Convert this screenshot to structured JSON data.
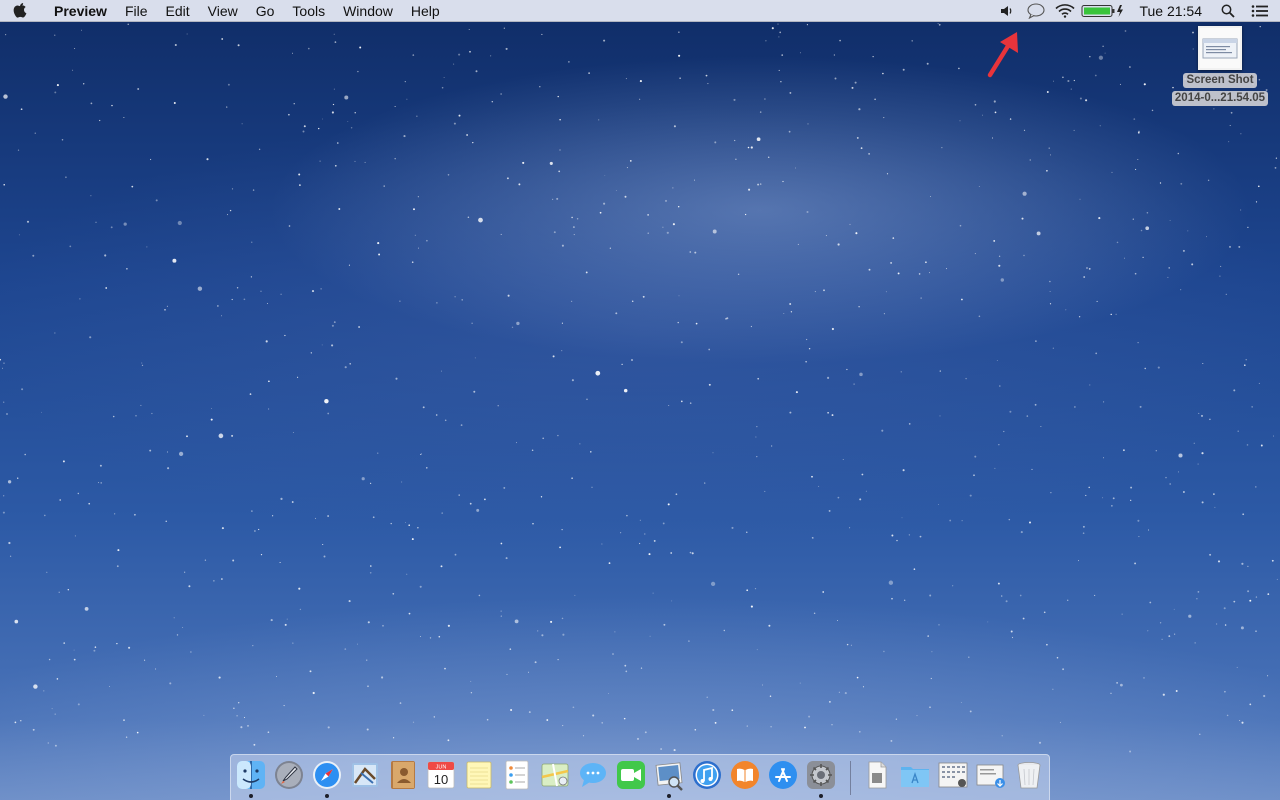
{
  "app": "Preview",
  "menubar": {
    "items": [
      {
        "name": "menu-file",
        "label": "File"
      },
      {
        "name": "menu-edit",
        "label": "Edit"
      },
      {
        "name": "menu-view",
        "label": "View"
      },
      {
        "name": "menu-go",
        "label": "Go"
      },
      {
        "name": "menu-tools",
        "label": "Tools"
      },
      {
        "name": "menu-window",
        "label": "Window"
      },
      {
        "name": "menu-help",
        "label": "Help"
      }
    ],
    "status": {
      "icons": [
        "volume-icon",
        "notification-bubble-icon",
        "wifi-icon",
        "battery-charging-icon",
        "spotlight-search-icon",
        "notification-center-icon"
      ],
      "clock": "Tue 21:54"
    }
  },
  "desktop": {
    "file": {
      "name_line1": "Screen Shot",
      "name_line2": "2014-0...21.54.05"
    },
    "annotation": "red-arrow-icon"
  },
  "dock": {
    "apps": [
      {
        "icon": "finder-icon",
        "running": true
      },
      {
        "icon": "launchpad-icon",
        "running": false
      },
      {
        "icon": "safari-icon",
        "running": true
      },
      {
        "icon": "mail-icon",
        "running": false
      },
      {
        "icon": "contacts-icon",
        "running": false
      },
      {
        "icon": "calendar-icon",
        "running": false,
        "month": "JUN",
        "day": "10"
      },
      {
        "icon": "notes-icon",
        "running": false
      },
      {
        "icon": "reminders-icon",
        "running": false
      },
      {
        "icon": "maps-icon",
        "running": false
      },
      {
        "icon": "messages-icon",
        "running": false
      },
      {
        "icon": "facetime-icon",
        "running": false
      },
      {
        "icon": "preview-icon",
        "running": true
      },
      {
        "icon": "itunes-icon",
        "running": false
      },
      {
        "icon": "ibooks-icon",
        "running": false
      },
      {
        "icon": "app-store-icon",
        "running": false
      },
      {
        "icon": "system-preferences-icon",
        "running": true
      }
    ],
    "stacks": [
      {
        "icon": "document-stack-icon"
      },
      {
        "icon": "applications-folder-icon"
      },
      {
        "icon": "screenshots-stack-icon"
      },
      {
        "icon": "downloads-stack-icon"
      },
      {
        "icon": "trash-icon"
      }
    ],
    "colors": {
      "background": "#c8d6ee",
      "running_dot": "#1d1f2a"
    }
  },
  "colors": {
    "arrow": "#e8343b",
    "sky_top": "#0f2c66",
    "sky_bottom": "#6a8cc6"
  }
}
